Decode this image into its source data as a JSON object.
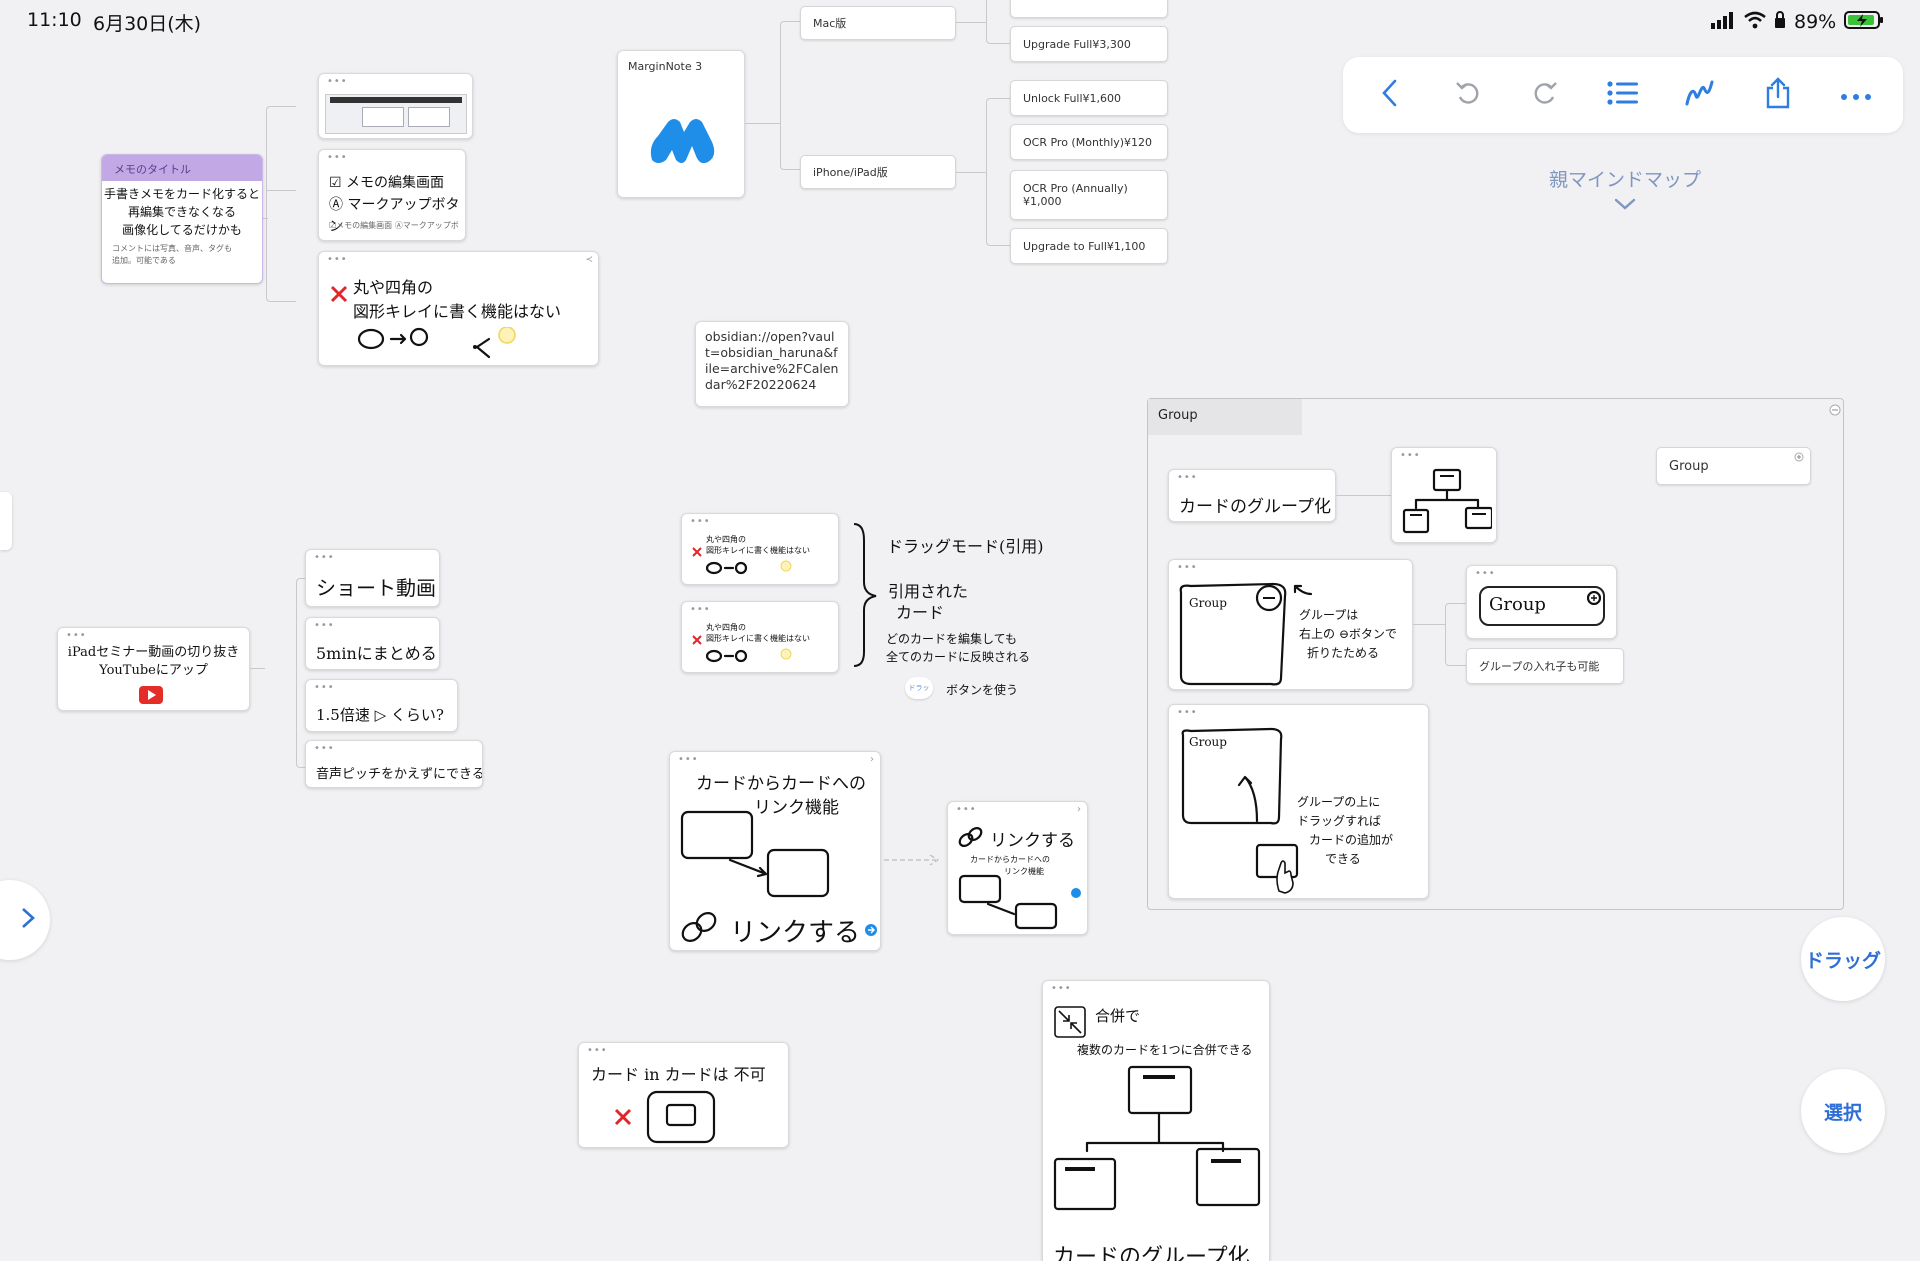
{
  "status_bar": {
    "time": "11:10",
    "date": "6月30日(木)",
    "battery": "89%"
  },
  "parent_mindmap": {
    "label": "親マインドマップ"
  },
  "marginnote": {
    "title": "MarginNote 3",
    "mac": "Mac版",
    "ipad": "iPhone/iPad版",
    "mac_items": [
      "Upgrade Full¥3,300"
    ],
    "ipad_items": [
      "Unlock Full¥1,600",
      "OCR Pro (Monthly)¥120",
      "OCR Pro (Annually)",
      "¥1,000",
      "Upgrade to Full¥1,100"
    ]
  },
  "memo_card": {
    "title": "メモのタイトル",
    "line1": "手書きメモをカード化すると",
    "line2": "再編集できなくなる",
    "line3": "画像化してるだけかも",
    "footer1": "コメントには写真、音声、タグも",
    "footer2": "追加。可能である"
  },
  "memo_children": {
    "edit1": "☑ メモの編集画面",
    "edit2": "Ⓐ マークアップボタン",
    "edit_caption": "☑メモの編集画面 Ⓐマークアップボ",
    "shape1": "丸や四角の",
    "shape2": "図形キレイに書く機能はない"
  },
  "obsidian": {
    "url": "obsidian://open?vault=obsidian_haruna&file=archive%2FCalendar%2F20220624"
  },
  "video": {
    "root1": "iPadセミナー動画の切り抜き",
    "root2": "YouTubeにアップ",
    "children": [
      "ショート動画",
      "5minにまとめる",
      "1.5倍速 ▷ くらい?",
      "音声ピッチをかえずにできる?"
    ]
  },
  "drag": {
    "mode": "ドラッグモード(引用)",
    "quoted1": "引用された",
    "quoted2": "カード",
    "edit1": "どのカードを編集しても",
    "edit2": "全てのカードに反映される",
    "button_hint": "ボタンを使う",
    "mini_line1": "丸や四角の",
    "mini_line2": "図形キレイに書く機能はない"
  },
  "link": {
    "title1": "カードからカードへの",
    "title2": "リンク機能",
    "action": "リンクする",
    "small_action": "リンクする",
    "small_caption1": "カードからカードへの",
    "small_caption2": "リンク機能"
  },
  "card_in_card": {
    "text": "カード in カードは 不可"
  },
  "merge": {
    "title": "合併で",
    "sub": "複数のカードを1つに合併できる",
    "bottom": "カードのグループ化"
  },
  "group": {
    "title": "Group",
    "pill_group": "Group",
    "card_grouping": "カードのグループ化",
    "note_box": "Group",
    "fold1": "グループは",
    "fold2": "右上の ⊖ボタンで",
    "fold3": "折りたためる",
    "nested_label": "Group",
    "nested_caption": "グループの入れ子も可能",
    "drag_box": "Group",
    "drag1": "グループの上に",
    "drag2": "ドラッグすれば",
    "drag3": "カードの追加が",
    "drag4": "できる"
  },
  "buttons": {
    "drag": "ドラッグ",
    "select": "選択"
  },
  "toolbar": [
    "back-icon",
    "undo-icon",
    "redo-icon",
    "outline-icon",
    "pen-icon",
    "share-icon",
    "more-icon"
  ]
}
